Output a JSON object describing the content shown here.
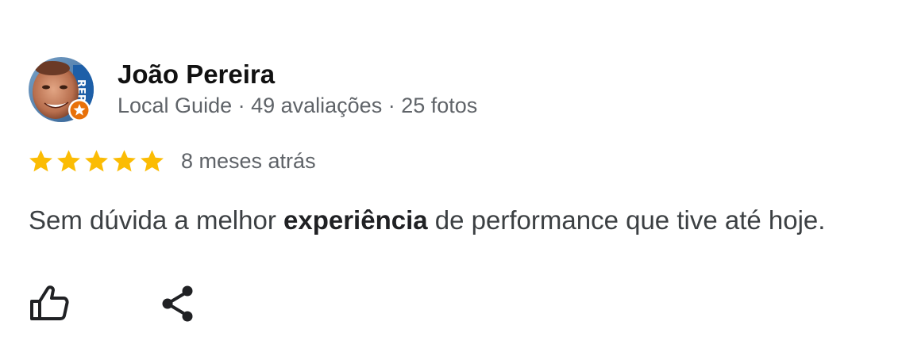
{
  "reviewer": {
    "name": "João Pereira",
    "meta": "Local Guide · 49 avaliações · 25 fotos",
    "avatar_icon": "person-photo",
    "badge_icon": "local-guide-star-icon",
    "badge_color": "#e8710a"
  },
  "review": {
    "rating": 5,
    "rating_max": 5,
    "star_color": "#fbbc04",
    "date": "8 meses atrás",
    "text_before": "Sem dúvida a melhor ",
    "text_bold": "experiência",
    "text_after": " de performance que tive até hoje."
  },
  "actions": {
    "like_icon": "thumb-up-icon",
    "share_icon": "share-icon"
  }
}
